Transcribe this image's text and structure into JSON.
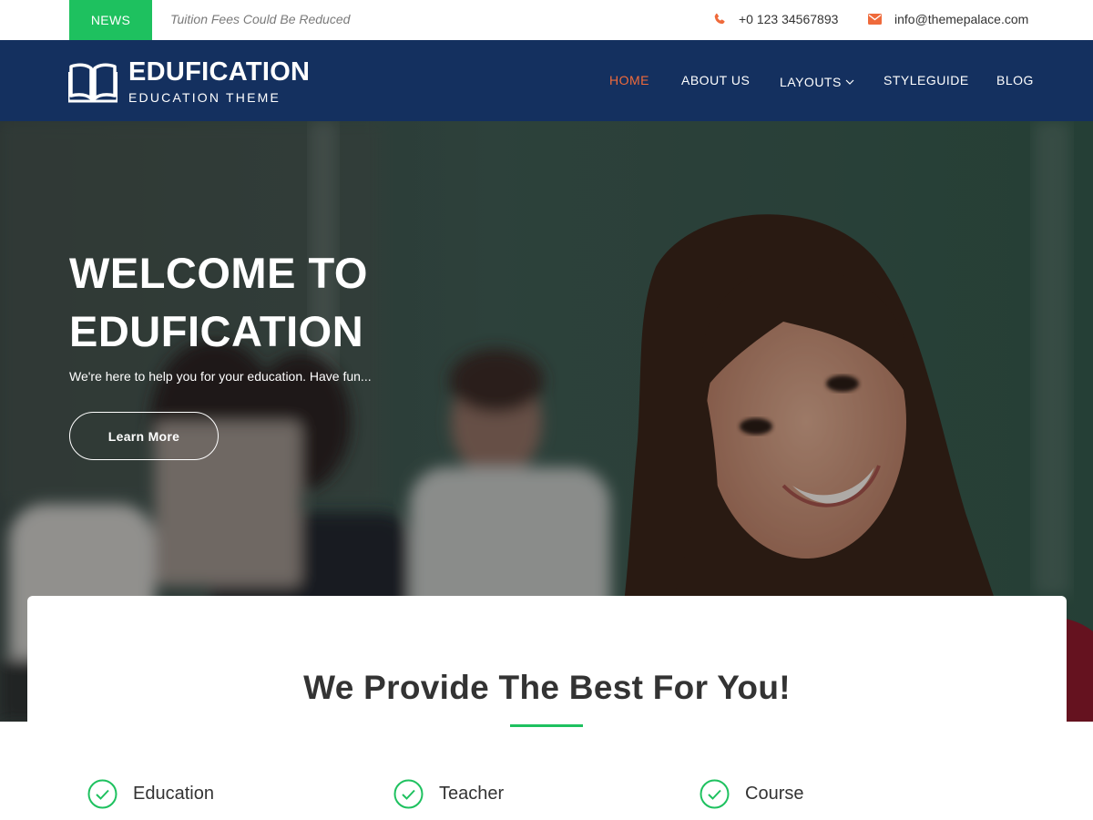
{
  "topbar": {
    "news_label": "NEWS",
    "news_headline": "Tuition Fees Could Be Reduced",
    "phone": "+0 123 34567893",
    "email": "info@themepalace.com",
    "icons": {
      "phone": "phone-icon",
      "email": "envelope-icon"
    }
  },
  "header": {
    "site_title": "EDUFICATION",
    "site_tagline": "EDUCATION THEME",
    "logo_icon": "open-book-icon"
  },
  "nav": {
    "items": [
      {
        "label": "HOME",
        "active": true
      },
      {
        "label": "ABOUT US",
        "active": false
      },
      {
        "label": "LAYOUTS",
        "active": false,
        "has_dropdown": true
      },
      {
        "label": "STYLEGUIDE",
        "active": false
      },
      {
        "label": "BLOG",
        "active": false
      }
    ]
  },
  "hero": {
    "title_line1": "WELCOME TO",
    "title_line2": "EDUFICATION",
    "subtitle": "We're here to help you for your education. Have fun...",
    "button_label": "Learn More"
  },
  "services": {
    "heading": "We Provide The Best For You!",
    "features": [
      {
        "label": "Education",
        "icon": "check-circle-icon"
      },
      {
        "label": "Teacher",
        "icon": "check-circle-icon"
      },
      {
        "label": "Course",
        "icon": "check-circle-icon"
      }
    ]
  },
  "colors": {
    "accent_green": "#1ec15f",
    "header_navy": "#14305f",
    "active_nav": "#ef6a3b",
    "icon_orange": "#ef6a3b"
  }
}
